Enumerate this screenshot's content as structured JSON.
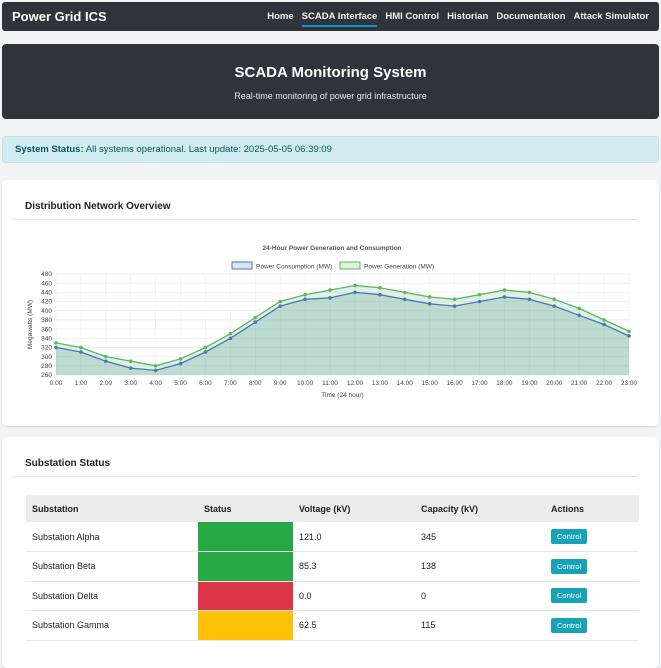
{
  "nav": {
    "brand": "Power Grid ICS",
    "links": [
      "Home",
      "SCADA Interface",
      "HMI Control",
      "Historian",
      "Documentation",
      "Attack Simulator"
    ],
    "active_index": 1
  },
  "hero": {
    "title": "SCADA Monitoring System",
    "subtitle": "Real-time monitoring of power grid infrastructure"
  },
  "alert": {
    "label": "System Status:",
    "text": " All systems operational. Last update: 2025-05-05 06:39:09"
  },
  "overview": {
    "title": "Distribution Network Overview"
  },
  "chart_data": {
    "type": "line",
    "title": "24-Hour Power Generation and Consumption",
    "xlabel": "Time (24 hour)",
    "ylabel": "Megawatts (MW)",
    "ylim": [
      260,
      480
    ],
    "yticks": [
      260,
      280,
      300,
      320,
      340,
      360,
      380,
      400,
      420,
      440,
      460,
      480
    ],
    "legend_position": "top-center",
    "grid": true,
    "categories": [
      "0:00",
      "1:00",
      "2:00",
      "3:00",
      "4:00",
      "5:00",
      "6:00",
      "7:00",
      "8:00",
      "9:00",
      "10:00",
      "11:00",
      "12:00",
      "13:00",
      "14:00",
      "15:00",
      "16:00",
      "17:00",
      "18:00",
      "19:00",
      "20:00",
      "21:00",
      "22:00",
      "23:00"
    ],
    "series": [
      {
        "name": "Power Consumption (MW)",
        "color": "#4a78b5",
        "values": [
          320,
          310,
          290,
          275,
          270,
          285,
          310,
          340,
          375,
          410,
          425,
          428,
          440,
          435,
          425,
          415,
          410,
          420,
          430,
          425,
          410,
          390,
          370,
          345
        ]
      },
      {
        "name": "Power Generation (MW)",
        "color": "#5cb85c",
        "values": [
          330,
          320,
          300,
          290,
          280,
          295,
          320,
          350,
          385,
          420,
          435,
          445,
          455,
          450,
          440,
          430,
          425,
          435,
          445,
          440,
          425,
          405,
          380,
          355
        ]
      }
    ]
  },
  "substations": {
    "title": "Substation Status",
    "headers": [
      "Substation",
      "Status",
      "Voltage (kV)",
      "Capacity (kV)",
      "Actions"
    ],
    "rows": [
      {
        "name": "Substation Alpha",
        "status_color": "#28a745",
        "voltage": "121.0",
        "capacity": "345",
        "action": "Control"
      },
      {
        "name": "Substation Beta",
        "status_color": "#28a745",
        "voltage": "85.3",
        "capacity": "138",
        "action": "Control"
      },
      {
        "name": "Substation Delta",
        "status_color": "#dc3545",
        "voltage": "0.0",
        "capacity": "0",
        "action": "Control"
      },
      {
        "name": "Substation Gamma",
        "status_color": "#ffc107",
        "voltage": "62.5",
        "capacity": "115",
        "action": "Control"
      }
    ]
  }
}
